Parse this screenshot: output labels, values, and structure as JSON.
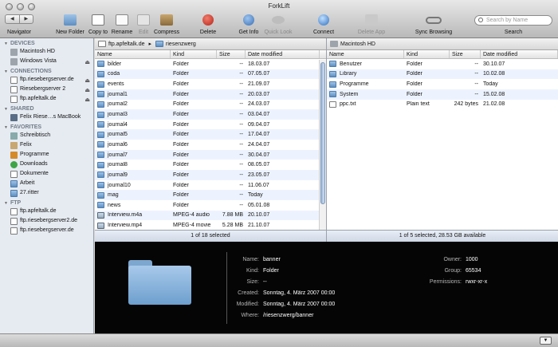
{
  "window": {
    "title": "ForkLift"
  },
  "toolbar": {
    "navigator_label": "Navigator",
    "new_folder": "New Folder",
    "copy_to": "Copy to",
    "rename": "Rename",
    "edit": "Edit",
    "compress": "Compress",
    "delete": "Delete",
    "get_info": "Get Info",
    "quick_look": "Quick Look",
    "connect": "Connect",
    "delete_app": "Delete App",
    "sync_browsing": "Sync Browsing",
    "search_placeholder": "Search by Name",
    "search_label": "Search"
  },
  "sidebar": {
    "devices_title": "DEVICES",
    "devices": [
      "Macintosh HD",
      "Windows Vista"
    ],
    "connections_title": "CONNECTIONS",
    "connections": [
      "ftp.riesebergserver.de",
      "Riesebergserver 2",
      "ftp.apfeltalk.de"
    ],
    "shared_title": "SHARED",
    "shared": [
      "Felix Riese…s MacBook"
    ],
    "favorites_title": "FAVORITES",
    "favorites": [
      "Schreibtisch",
      "Felix",
      "Programme",
      "Downloads",
      "Dokumente",
      "Arbeit",
      "27.ritter"
    ],
    "ftp_title": "FTP",
    "ftp": [
      "ftp.apfeltalk.de",
      "ftp.riesebergserver2.de",
      "ftp.riesebergserver.de"
    ]
  },
  "left_pane": {
    "path": [
      "ftp.apfeltalk.de",
      "riesenzwerg"
    ],
    "columns": [
      "Name",
      "Kind",
      "Size",
      "Date modified"
    ],
    "rows": [
      [
        "bilder",
        "Folder",
        "--",
        "18.03.07"
      ],
      [
        "coda",
        "Folder",
        "--",
        "07.05.07"
      ],
      [
        "events",
        "Folder",
        "--",
        "21.09.07"
      ],
      [
        "journal1",
        "Folder",
        "--",
        "20.03.07"
      ],
      [
        "journal2",
        "Folder",
        "--",
        "24.03.07"
      ],
      [
        "journal3",
        "Folder",
        "--",
        "03.04.07"
      ],
      [
        "journal4",
        "Folder",
        "--",
        "09.04.07"
      ],
      [
        "journal5",
        "Folder",
        "--",
        "17.04.07"
      ],
      [
        "journal6",
        "Folder",
        "--",
        "24.04.07"
      ],
      [
        "journal7",
        "Folder",
        "--",
        "30.04.07"
      ],
      [
        "journal8",
        "Folder",
        "--",
        "08.05.07"
      ],
      [
        "journal9",
        "Folder",
        "--",
        "23.05.07"
      ],
      [
        "journal10",
        "Folder",
        "--",
        "11.06.07"
      ],
      [
        "mag",
        "Folder",
        "--",
        "Today"
      ],
      [
        "news",
        "Folder",
        "--",
        "05.01.08"
      ],
      [
        "Interview.m4a",
        "MPEG-4 audio",
        "7.88 MB",
        "20.10.07"
      ],
      [
        "Interview.mp4",
        "MPEG-4 movie",
        "5.28 MB",
        "21.10.07"
      ]
    ],
    "status": "1 of 18 selected"
  },
  "right_pane": {
    "path": [
      "Macintosh HD"
    ],
    "columns": [
      "Name",
      "Kind",
      "Size",
      "Date modified"
    ],
    "rows": [
      [
        "Benutzer",
        "Folder",
        "--",
        "30.10.07"
      ],
      [
        "Library",
        "Folder",
        "--",
        "10.02.08"
      ],
      [
        "Programme",
        "Folder",
        "--",
        "Today"
      ],
      [
        "System",
        "Folder",
        "--",
        "15.02.08"
      ],
      [
        "ppc.txt",
        "Plain text",
        "242 bytes",
        "21.02.08"
      ]
    ],
    "status": "1 of 5 selected, 28.53 GB available"
  },
  "info": {
    "name_label": "Name:",
    "name": "banner",
    "kind_label": "Kind:",
    "kind": "Folder",
    "size_label": "Size:",
    "size": "--",
    "created_label": "Created:",
    "created": "Sonntag, 4. März 2007 00:00",
    "modified_label": "Modified:",
    "modified": "Sonntag, 4. März 2007 00:00",
    "where_label": "Where:",
    "where": "/riesenzwerg/banner",
    "owner_label": "Owner:",
    "owner": "1000",
    "group_label": "Group:",
    "group": "65534",
    "permissions_label": "Permissions:",
    "permissions": "rwxr-xr-x"
  }
}
